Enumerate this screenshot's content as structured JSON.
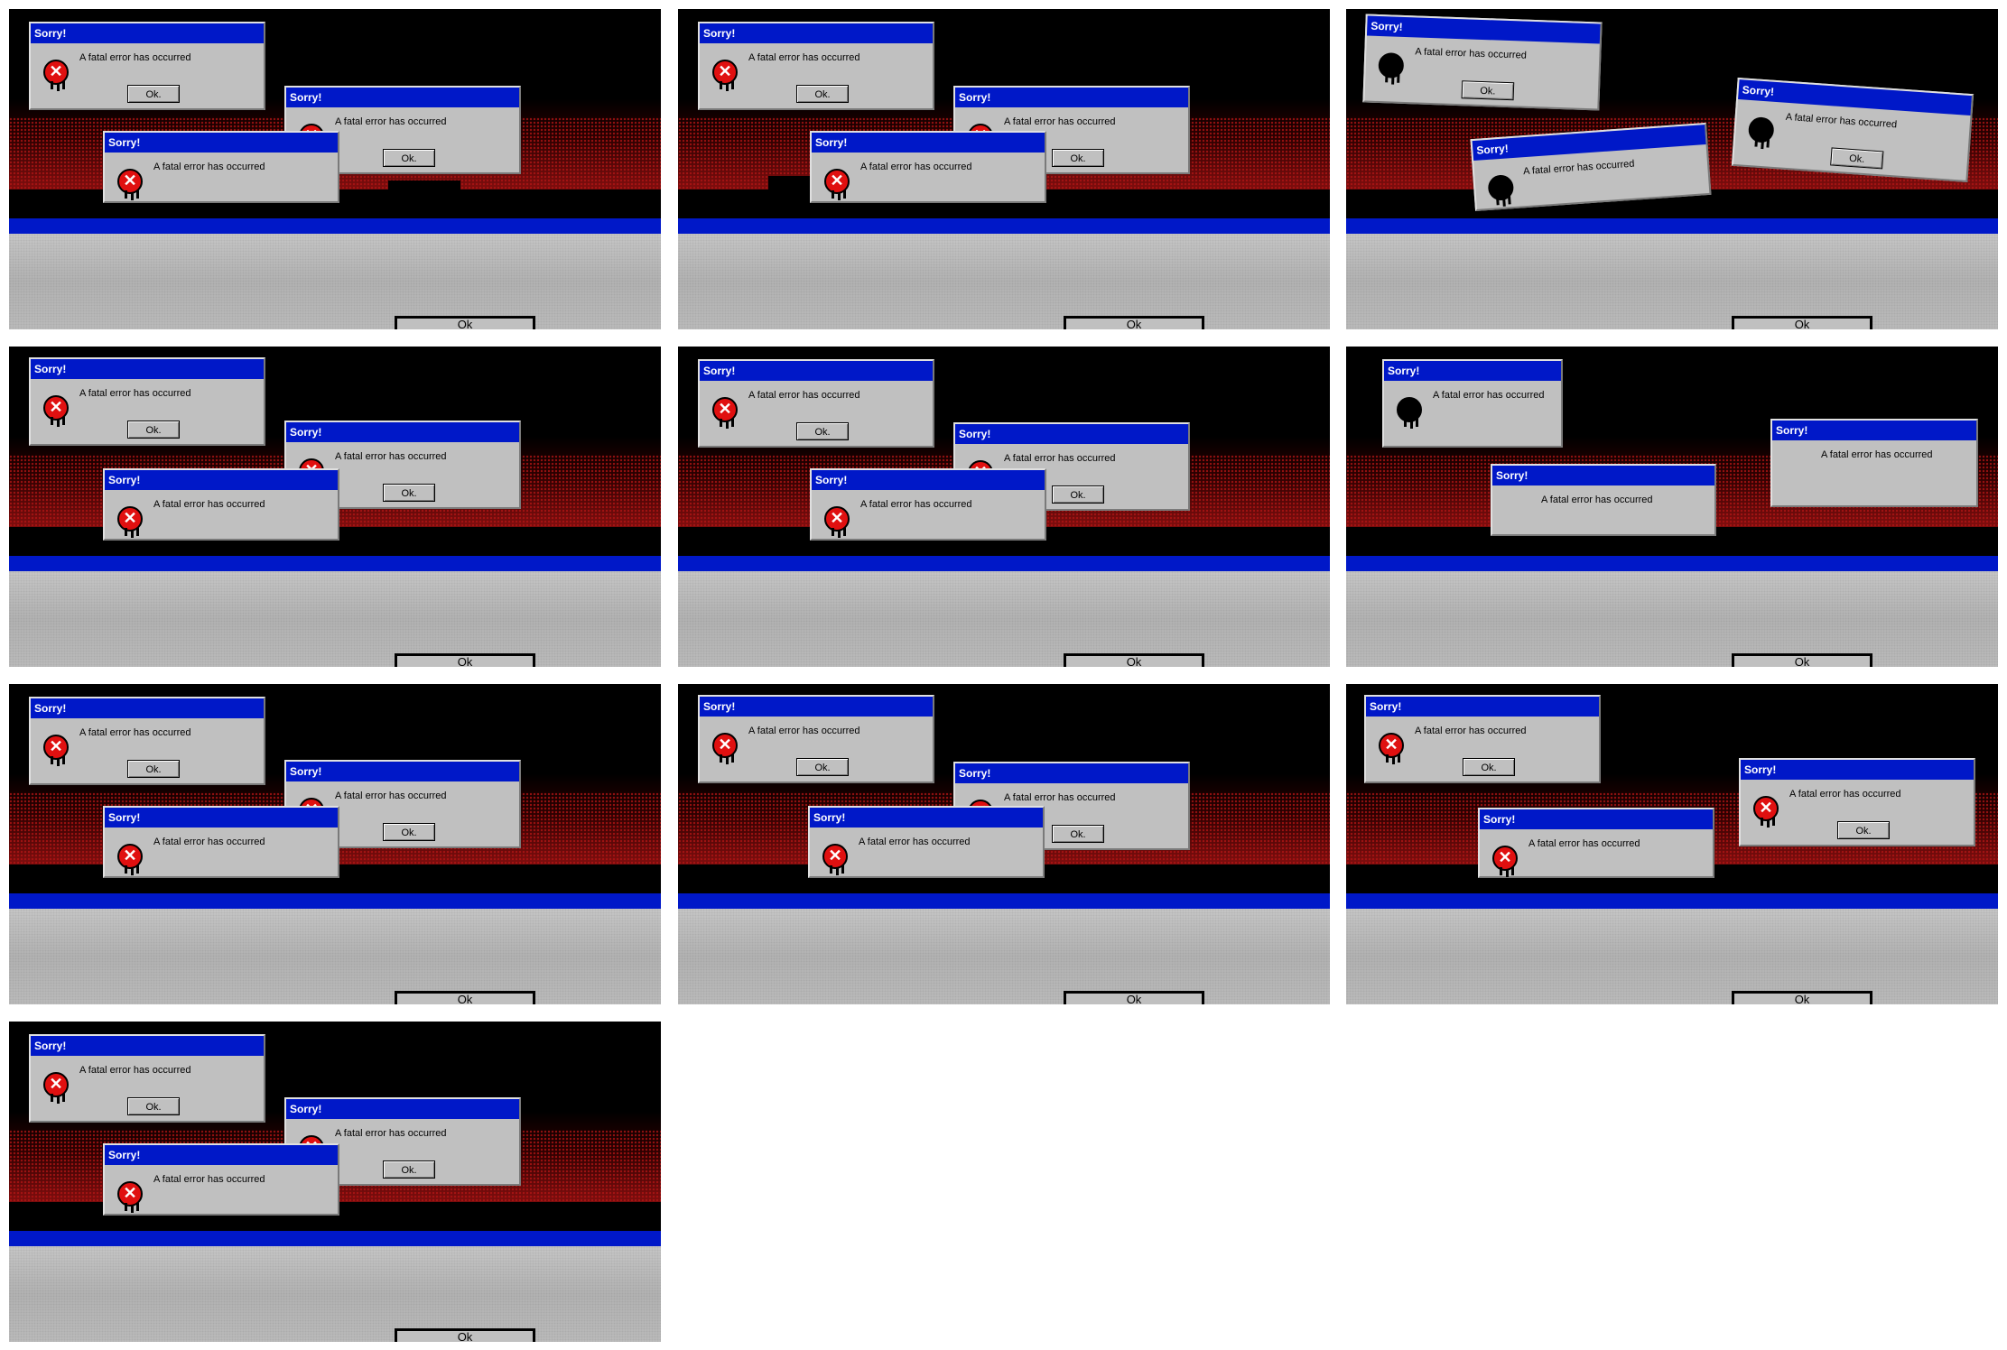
{
  "dialog": {
    "title": "Sorry!",
    "message": "A fatal error has occurred",
    "ok_label": "Ok."
  },
  "floor_button_label": "Ok",
  "frames_count_label": "",
  "colors": {
    "titlebar": "#0018c8",
    "dialog_bg": "#c0c0c0",
    "error_icon": "#e01010",
    "blood": "#7a0d0d",
    "floor": "#c0c0c0"
  },
  "icons": [
    "error-x-icon"
  ]
}
